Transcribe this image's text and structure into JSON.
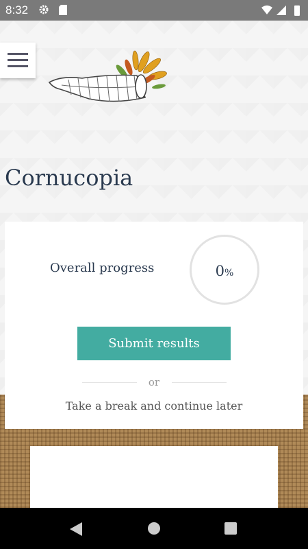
{
  "status_bar": {
    "time": "8:32",
    "icons": [
      "gear-icon",
      "sd-card-icon",
      "wifi-icon",
      "signal-icon",
      "battery-icon"
    ]
  },
  "header": {
    "menu_icon": "hamburger-menu-icon",
    "logo": "cornucopia-logo"
  },
  "page": {
    "title": "Cornucopia"
  },
  "progress_card": {
    "label": "Overall progress",
    "value": "0",
    "unit": "%",
    "progress_fraction": 0,
    "submit_label": "Submit results",
    "or_label": "or",
    "break_label": "Take a break and continue later"
  },
  "colors": {
    "accent": "#43aca1",
    "title": "#2a3a4f"
  },
  "nav_bar": {
    "icons": [
      "back-icon",
      "home-icon",
      "recents-icon"
    ]
  }
}
